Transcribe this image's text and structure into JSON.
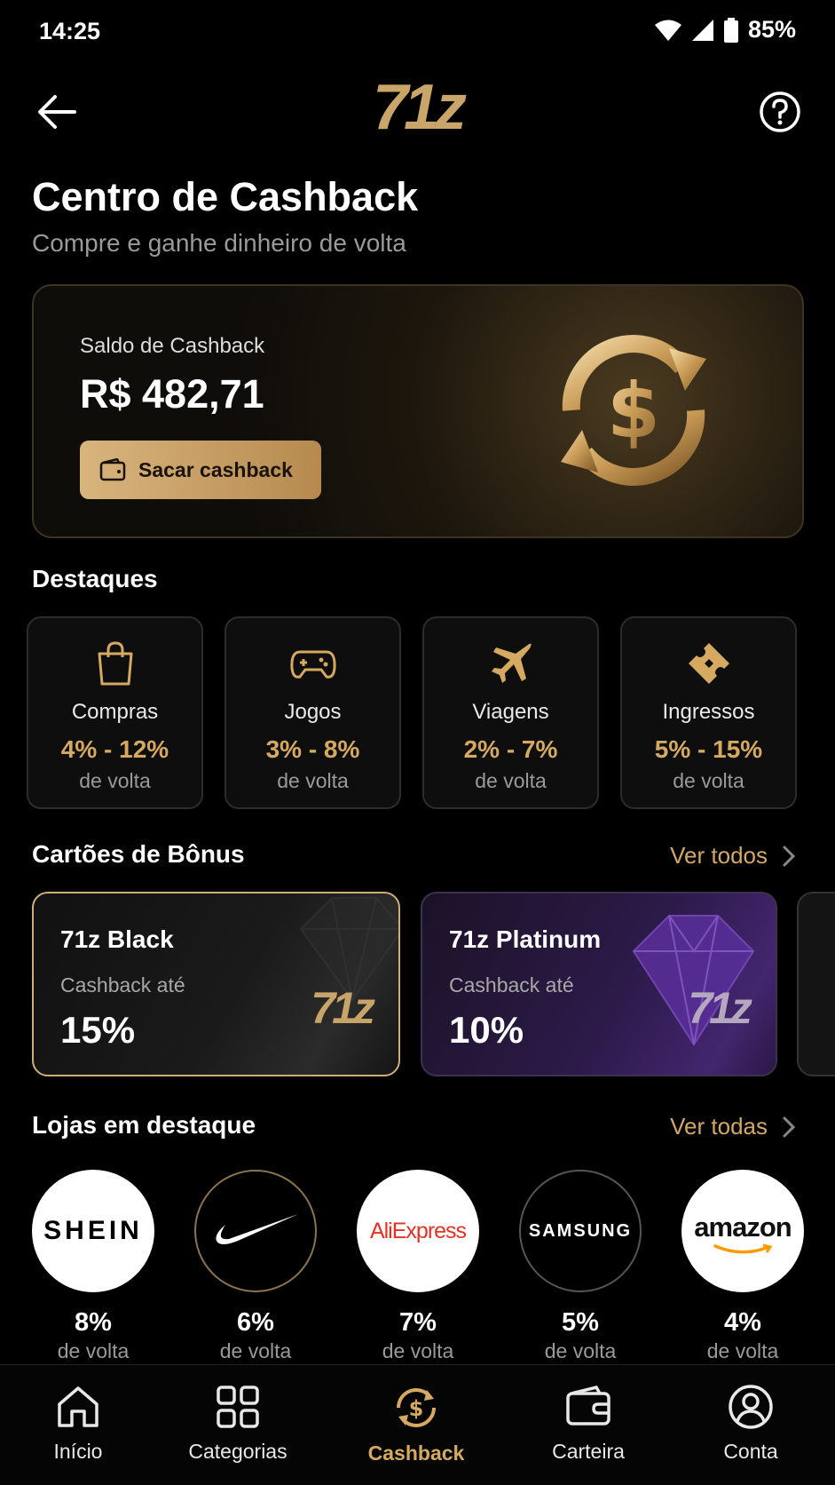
{
  "status": {
    "time": "14:25",
    "battery": "85%"
  },
  "app": {
    "logo": "71z"
  },
  "header": {
    "title": "Centro de Cashback",
    "subtitle": "Compre e ganhe dinheiro de volta"
  },
  "balance": {
    "label": "Saldo de Cashback",
    "value": "R$ 482,71",
    "button": "Sacar cashback"
  },
  "highlights": {
    "title": "Destaques",
    "items": [
      {
        "name": "Compras",
        "range": "4% - 12%",
        "back": "de volta",
        "icon": "shopping-bag-icon"
      },
      {
        "name": "Jogos",
        "range": "3% - 8%",
        "back": "de volta",
        "icon": "gamepad-icon"
      },
      {
        "name": "Viagens",
        "range": "2% - 7%",
        "back": "de volta",
        "icon": "airplane-icon"
      },
      {
        "name": "Ingressos",
        "range": "5% - 15%",
        "back": "de volta",
        "icon": "ticket-icon"
      }
    ]
  },
  "bonus": {
    "title": "Cartões de Bônus",
    "see_all": "Ver todos",
    "cards": [
      {
        "name": "71z Black",
        "sub": "Cashback até",
        "pct": "15%",
        "logo": "71z"
      },
      {
        "name": "71z Platinum",
        "sub": "Cashback até",
        "pct": "10%",
        "logo": "71z"
      }
    ]
  },
  "stores": {
    "title": "Lojas em destaque",
    "see_all": "Ver todas",
    "items": [
      {
        "name": "SHEIN",
        "pct": "8%",
        "back": "de volta"
      },
      {
        "name": "Nike",
        "pct": "6%",
        "back": "de volta"
      },
      {
        "name": "AliExpress",
        "pct": "7%",
        "back": "de volta"
      },
      {
        "name": "SAMSUNG",
        "pct": "5%",
        "back": "de volta"
      },
      {
        "name": "amazon",
        "pct": "4%",
        "back": "de volta"
      }
    ]
  },
  "nav": {
    "items": [
      {
        "label": "Início",
        "icon": "home-icon"
      },
      {
        "label": "Categorias",
        "icon": "grid-icon"
      },
      {
        "label": "Cashback",
        "icon": "cashback-icon",
        "active": true
      },
      {
        "label": "Carteira",
        "icon": "wallet-icon"
      },
      {
        "label": "Conta",
        "icon": "account-icon"
      }
    ]
  },
  "colors": {
    "accent": "#d6a961",
    "background": "#000000",
    "platinum": "#3a2268"
  }
}
